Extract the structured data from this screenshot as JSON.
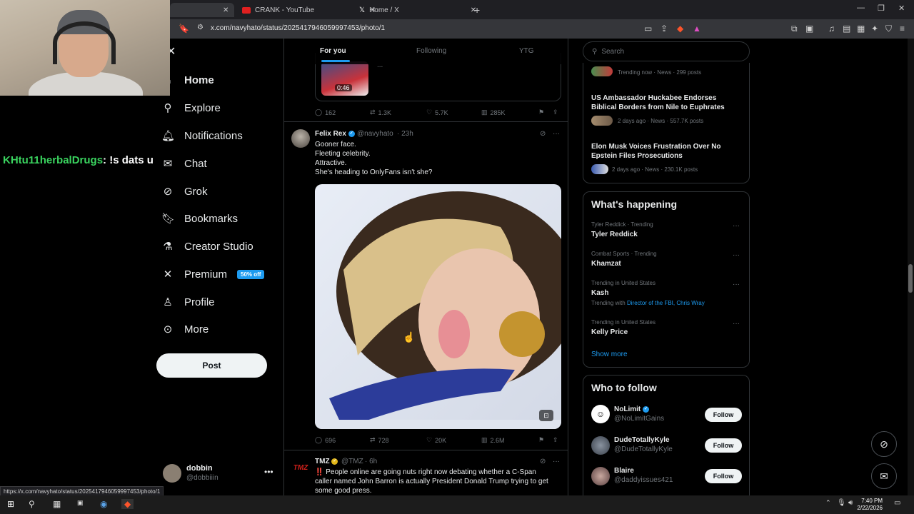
{
  "browser": {
    "tabs": [
      {
        "label": "",
        "active": true
      },
      {
        "label": "CRANK - YouTube"
      },
      {
        "label": "Home / X"
      }
    ],
    "url": "x.com/navyhato/status/2025417946059997453/photo/1",
    "status_url": "https://x.com/navyhato/status/2025417946059997453/photo/1"
  },
  "stream_chat": {
    "user": "Htu11herbalDrugs",
    "message": "!s dats u"
  },
  "sidebar": {
    "items": [
      {
        "label": "Home",
        "icon": "home-icon"
      },
      {
        "label": "Explore",
        "icon": "search-icon"
      },
      {
        "label": "Notifications",
        "icon": "bell-icon"
      },
      {
        "label": "Chat",
        "icon": "mail-icon"
      },
      {
        "label": "Grok",
        "icon": "grok-icon"
      },
      {
        "label": "Bookmarks",
        "icon": "bookmark-icon"
      },
      {
        "label": "Creator Studio",
        "icon": "flask-icon"
      },
      {
        "label": "Premium",
        "icon": "x-logo-icon"
      },
      {
        "label": "Profile",
        "icon": "person-icon"
      },
      {
        "label": "More",
        "icon": "more-circle-icon"
      }
    ],
    "premium_badge": "50% off",
    "post_label": "Post",
    "account": {
      "name": "dobbin",
      "handle": "@dobbiiin"
    }
  },
  "timeline": {
    "tabs": [
      "For you",
      "Following",
      "YTG"
    ],
    "prev_post": {
      "video_duration": "0:46",
      "snippet": "...",
      "replies": "162",
      "reposts": "1.3K",
      "likes": "5.7K",
      "views": "285K"
    },
    "post1": {
      "name": "Felix Rex",
      "handle": "@navyhato",
      "time": "· 23h",
      "lines": [
        "Gooner face.",
        "Fleeting celebrity.",
        "Attractive.",
        "She's heading to OnlyFans isn't she?"
      ],
      "replies": "696",
      "reposts": "728",
      "likes": "20K",
      "views": "2.6M"
    },
    "post2": {
      "name": "TMZ",
      "handle": "@TMZ",
      "time": "· 6h",
      "lines": [
        "‼️ People online are going nuts right now debating whether a C-Span",
        "caller named John Barron is actually President Donald Trump trying to get",
        "some good press."
      ]
    }
  },
  "right": {
    "search_placeholder": "Search",
    "news": [
      {
        "title": "",
        "meta": "Trending now · News · 299 posts"
      },
      {
        "title": "US Ambassador Huckabee Endorses Biblical Borders from Nile to Euphrates",
        "title_lines": [
          "US Ambassador Huckabee Endorses",
          "Biblical Borders from Nile to Euphrates"
        ],
        "meta": "2 days ago · News · 557.7K posts"
      },
      {
        "title": "Elon Musk Voices Frustration Over No Epstein Files Prosecutions",
        "title_lines": [
          "Elon Musk Voices Frustration Over No",
          "Epstein Files Prosecutions"
        ],
        "meta": "2 days ago · News · 230.1K posts"
      }
    ],
    "happening": {
      "title": "What's happening",
      "trends": [
        {
          "context": "Tyler Reddick · Trending",
          "name": "Tyler Reddick"
        },
        {
          "context": "Combat Sports · Trending",
          "name": "Khamzat"
        },
        {
          "context": "Trending in United States",
          "name": "Kash",
          "with_label": "Trending with",
          "with_links": "Director of the FBI, Chris Wray"
        },
        {
          "context": "Trending in United States",
          "name": "Kelly Price"
        }
      ],
      "show_more": "Show more"
    },
    "who_to_follow": {
      "title": "Who to follow",
      "accounts": [
        {
          "name": "NoLimit",
          "handle": "@NoLimitGains"
        },
        {
          "name": "DudeTotallyKyle",
          "handle": "@DudeTotallyKyle"
        },
        {
          "name": "Blaire",
          "handle": "@daddyissues421"
        }
      ],
      "follow_label": "Follow"
    }
  },
  "taskbar": {
    "time": "7:40 PM",
    "date": "2/22/2026"
  },
  "colors": {
    "accent": "#1d9bf0",
    "background": "#000000",
    "border": "#2f3336",
    "muted": "#71767b"
  }
}
